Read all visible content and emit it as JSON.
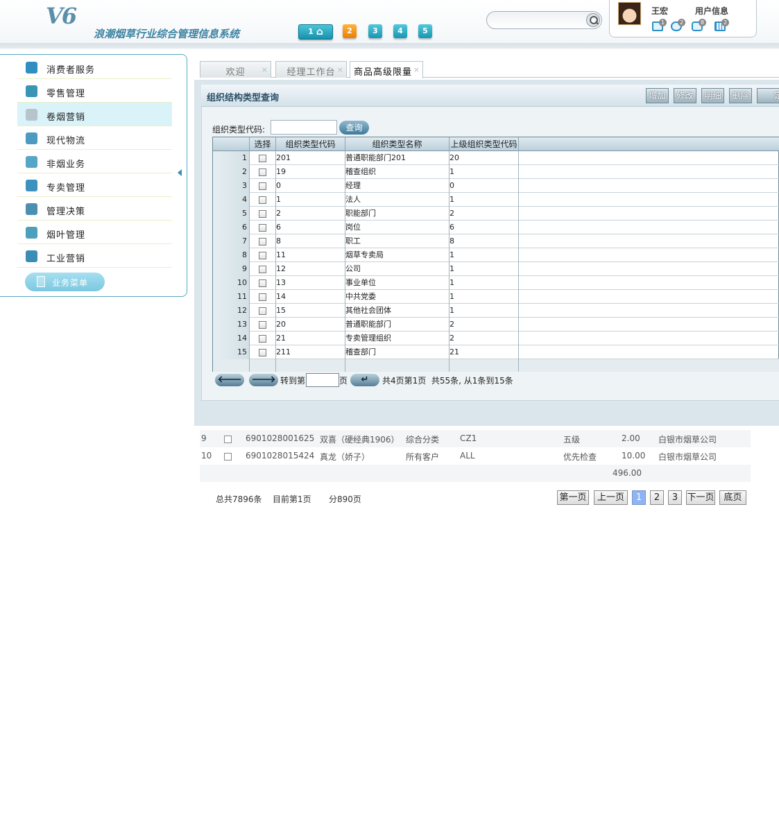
{
  "header": {
    "logo": "V6",
    "system_name": "浪潮烟草行业综合管理信息系统",
    "nav_buttons": [
      "1",
      "2",
      "3",
      "4",
      "5"
    ],
    "search_value": "",
    "user_name": "王宏",
    "user_info_label": "用户信息",
    "badges": {
      "mail": "1",
      "chat": "2",
      "messages": "8",
      "calendar": "2"
    }
  },
  "sidebar": {
    "items": [
      {
        "label": "消费者服务",
        "icon": "person-icon",
        "color": "#2f8fc1"
      },
      {
        "label": "零售管理",
        "icon": "shop-icon",
        "color": "#3a94b6"
      },
      {
        "label": "卷烟营销",
        "icon": "chart-icon",
        "color": "#b8c4cb"
      },
      {
        "label": "现代物流",
        "icon": "truck-icon",
        "color": "#4d9cc0"
      },
      {
        "label": "非烟业务",
        "icon": "cup-icon",
        "color": "#55a6c7"
      },
      {
        "label": "专卖管理",
        "icon": "house-icon",
        "color": "#3c92bd"
      },
      {
        "label": "管理决策",
        "icon": "gavel-icon",
        "color": "#4d8fb0"
      },
      {
        "label": "烟叶管理",
        "icon": "leaf-icon",
        "color": "#4ca0bb"
      },
      {
        "label": "工业营销",
        "icon": "gear-icon",
        "color": "#3c8db5"
      }
    ],
    "active_index": 2,
    "biz_menu": "业务菜单"
  },
  "tabs": [
    {
      "label": "欢迎"
    },
    {
      "label": "经理工作台"
    },
    {
      "label": "商品高级限量"
    }
  ],
  "panel": {
    "title": "组织结构类型查询",
    "toolbar": [
      "增加",
      "修改",
      "明细",
      "删除",
      "定"
    ],
    "query_label": "组织类型代码:",
    "query_value": "",
    "query_button": "查询"
  },
  "grid": {
    "columns": [
      "选择",
      "组织类型代码",
      "组织类型名称",
      "上级组织类型代码"
    ],
    "rows": [
      {
        "no": "1",
        "code": "201",
        "name": "普通职能部门201",
        "parent": "20"
      },
      {
        "no": "2",
        "code": "19",
        "name": "稽查组织",
        "parent": "1"
      },
      {
        "no": "3",
        "code": "0",
        "name": "经理",
        "parent": "0"
      },
      {
        "no": "4",
        "code": "1",
        "name": "法人",
        "parent": "1"
      },
      {
        "no": "5",
        "code": "2",
        "name": "职能部门",
        "parent": "2"
      },
      {
        "no": "6",
        "code": "6",
        "name": "岗位",
        "parent": "6"
      },
      {
        "no": "7",
        "code": "8",
        "name": "职工",
        "parent": "8"
      },
      {
        "no": "8",
        "code": "11",
        "name": "烟草专卖局",
        "parent": "1"
      },
      {
        "no": "9",
        "code": "12",
        "name": "公司",
        "parent": "1"
      },
      {
        "no": "10",
        "code": "13",
        "name": "事业单位",
        "parent": "1"
      },
      {
        "no": "11",
        "code": "14",
        "name": "中共党委",
        "parent": "1"
      },
      {
        "no": "12",
        "code": "15",
        "name": "其他社会团体",
        "parent": "1"
      },
      {
        "no": "13",
        "code": "20",
        "name": "普通职能部门",
        "parent": "2"
      },
      {
        "no": "14",
        "code": "21",
        "name": "专卖管理组织",
        "parent": "2"
      },
      {
        "no": "15",
        "code": "211",
        "name": "稽查部门",
        "parent": "21"
      }
    ],
    "pager": {
      "prev": "🡐",
      "next": "🡒",
      "goto_prefix": "转到第",
      "goto_suffix": "页",
      "go": "↵",
      "goto_value": "",
      "summary": "共4页第1页  共55条, 从1条到15条"
    }
  },
  "bg_list": {
    "rows": [
      {
        "no": "9",
        "barcode": "6901028001625",
        "name": "双喜（硬经典1906）",
        "category": "综合分类",
        "code": "CZ1",
        "level": "五级",
        "qty": "2.00",
        "company": "白银市烟草公司"
      },
      {
        "no": "10",
        "barcode": "6901028015424",
        "name": "真龙（娇子）",
        "category": "所有客户",
        "code": "ALL",
        "level": "优先检查",
        "qty": "10.00",
        "company": "白银市烟草公司"
      }
    ],
    "total": "496.00",
    "footer": {
      "total_records": "总共7896条",
      "current_page": "目前第1页",
      "pages": "分890页"
    },
    "pager": [
      "第一页",
      "上一页",
      "1",
      "2",
      "3",
      "下一页",
      "底页"
    ]
  }
}
